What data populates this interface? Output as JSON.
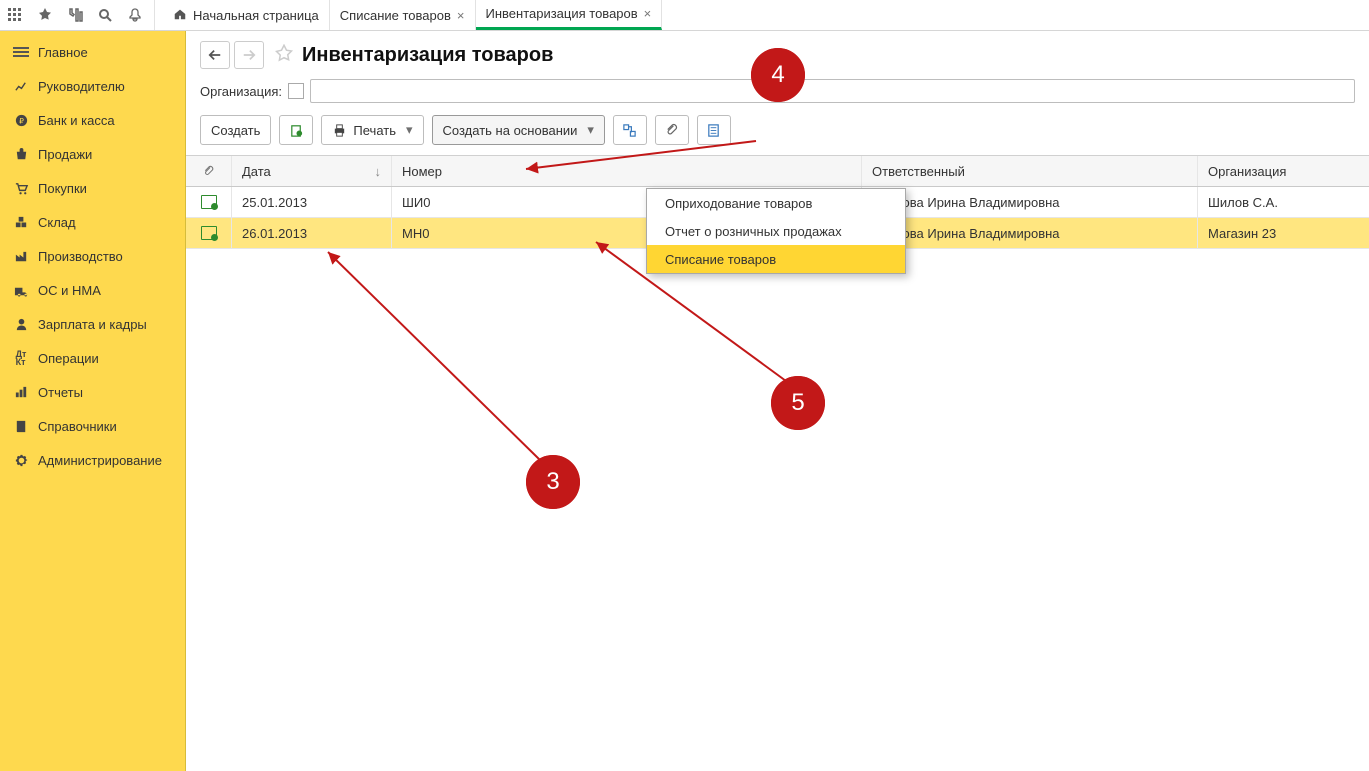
{
  "top_icons": [
    "apps",
    "star",
    "tree",
    "search",
    "bell"
  ],
  "tabs": {
    "home": "Начальная страница",
    "writeoff": "Списание товаров",
    "inventory": "Инвентаризация товаров"
  },
  "sidebar": [
    {
      "id": "main",
      "label": "Главное",
      "icon": "ham"
    },
    {
      "id": "manager",
      "label": "Руководителю",
      "icon": "chart"
    },
    {
      "id": "bank",
      "label": "Банк и касса",
      "icon": "ruble"
    },
    {
      "id": "sales",
      "label": "Продажи",
      "icon": "bag"
    },
    {
      "id": "purchases",
      "label": "Покупки",
      "icon": "cart"
    },
    {
      "id": "warehouse",
      "label": "Склад",
      "icon": "boxes"
    },
    {
      "id": "prod",
      "label": "Производство",
      "icon": "factory"
    },
    {
      "id": "os",
      "label": "ОС и НМА",
      "icon": "truck"
    },
    {
      "id": "hr",
      "label": "Зарплата и кадры",
      "icon": "person"
    },
    {
      "id": "ops",
      "label": "Операции",
      "icon": "dtkt"
    },
    {
      "id": "reports",
      "label": "Отчеты",
      "icon": "bars"
    },
    {
      "id": "refs",
      "label": "Справочники",
      "icon": "book"
    },
    {
      "id": "admin",
      "label": "Администрирование",
      "icon": "gear"
    }
  ],
  "page": {
    "title": "Инвентаризация товаров",
    "org_label": "Организация:"
  },
  "toolbar": {
    "create": "Создать",
    "print": "Печать",
    "create_based": "Создать на основании"
  },
  "columns": {
    "date": "Дата",
    "num": "Номер",
    "resp": "Ответственный",
    "org": "Организация"
  },
  "rows": [
    {
      "date": "25.01.2013",
      "num": "ШИ0",
      "resp": "Иванова Ирина Владимировна",
      "org": "Шилов С.А."
    },
    {
      "date": "26.01.2013",
      "num": "МН0",
      "resp": "Иванова Ирина Владимировна",
      "org": "Магазин 23"
    }
  ],
  "dropdown": {
    "item0": "Оприходование товаров",
    "item1": "Отчет о розничных продажах",
    "item2": "Списание товаров"
  },
  "markers": {
    "m3": "3",
    "m4": "4",
    "m5": "5"
  }
}
